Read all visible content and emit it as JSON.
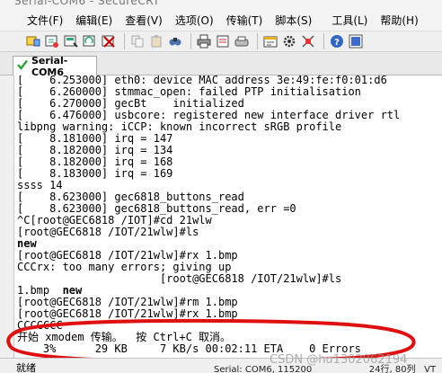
{
  "window": {
    "title": "Serial-COM6 - SecureCRT"
  },
  "menubar": {
    "items": [
      "文件(F)",
      "编辑(E)",
      "查看(V)",
      "选项(O)",
      "传输(T)",
      "脚本(S)",
      "工具(L)",
      "帮助(H)"
    ]
  },
  "tab": {
    "label": "Serial-COM6"
  },
  "terminal": {
    "lines": [
      "[    6.253000] eth0: device MAC address 3e:49:fe:f0:01:d6",
      "[    6.260000] stmmac_open: failed PTP initialisation",
      "[    6.270000] gecBt    initialized",
      "[    6.476000] usbcore: registered new interface driver rtl",
      "libpng warning: iCCP: known incorrect sRGB profile",
      "[    8.181000] irq = 147",
      "[    8.182000] irq = 134",
      "[    8.182000] irq = 168",
      "[    8.183000] irq = 169",
      "ssss 14",
      "[    8.623000] gec6818_buttons_read",
      "[    8.623000] gec6818_buttons_read, err =0",
      "^C[root@GEC6818 /IOT]#cd 21wlw",
      "[root@GEC6818 /IOT/21wlw]#ls",
      "new",
      "[root@GEC6818 /IOT/21wlw]#rx 1.bmp",
      "CCCrx: too many errors; giving up",
      "                      [root@GEC6818 /IOT/21wlw]#ls",
      "1.bmp  new",
      "[root@GEC6818 /IOT/21wlw]#rm 1.bmp",
      "[root@GEC6818 /IOT/21wlw]#rx 1.bmp",
      "CCCCCCC",
      "开始 xmodem 传输。  按 Ctrl+C 取消。",
      "    3%      29 KB     7 KB/s 00:02:11 ETA    0 Errors"
    ],
    "bold_words": {
      "line14": "new",
      "line18_new": "new"
    }
  },
  "statusbar": {
    "ready": "就绪",
    "session": "Serial: COM6, 115200",
    "position": "24行, 80列",
    "extra": "VT"
  },
  "watermark": "CSDN @hu1302062194",
  "colors": {
    "annotation": "#e01010",
    "tab_icon": "#2e9e2e",
    "menubar_bg": "#f3f3f3",
    "terminal_bg": "#ffffff"
  },
  "icons": [
    "connect-icon",
    "quick-connect-icon",
    "connect-in-tab-icon",
    "reconnect-icon",
    "disconnect-icon",
    "copy-icon",
    "paste-icon",
    "find-icon",
    "print-icon",
    "print-setup-icon",
    "print-screen-icon",
    "session-options-icon",
    "global-options-icon",
    "keymap-icon",
    "help-icon",
    "info-icon"
  ]
}
